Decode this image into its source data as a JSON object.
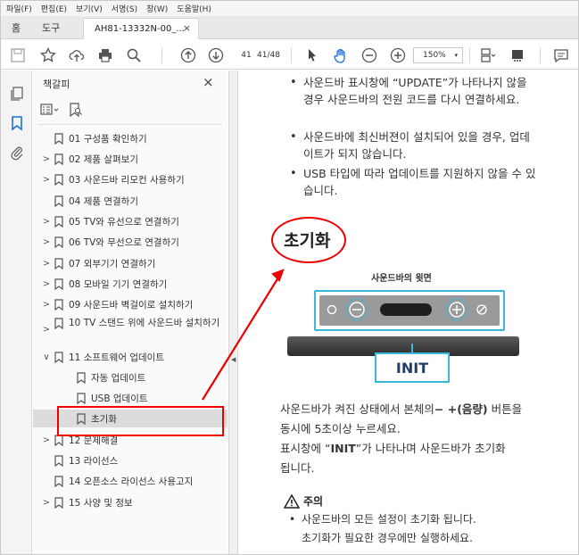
{
  "menu": [
    "파일(F)",
    "편집(E)",
    "보기(V)",
    "서명(S)",
    "창(W)",
    "도움말(H)"
  ],
  "tabs": {
    "home": "홈",
    "tools": "도구",
    "doc": "AH81-13332N-00_...",
    "close": "×"
  },
  "toolbar": {
    "page_current": "41",
    "page_total": "41/48",
    "zoom": "150%",
    "zoom_caret": "▾"
  },
  "panel": {
    "title": "책갈피",
    "close": "×",
    "items": [
      {
        "label": "01 구성품 확인하기",
        "expandable": false,
        "level": 0
      },
      {
        "label": "02 제품 살펴보기",
        "expandable": true,
        "level": 0
      },
      {
        "label": "03 사운드바 리모컨 사용하기",
        "expandable": true,
        "level": 0
      },
      {
        "label": "04 제품 연결하기",
        "expandable": false,
        "level": 0
      },
      {
        "label": "05 TV와 유선으로 연결하기",
        "expandable": true,
        "level": 0
      },
      {
        "label": "06 TV와 무선으로 연결하기",
        "expandable": true,
        "level": 0
      },
      {
        "label": "07 외부기기 연결하기",
        "expandable": true,
        "level": 0
      },
      {
        "label": "08 모바일 기기 연결하기",
        "expandable": true,
        "level": 0
      },
      {
        "label": "09 사운드바 벽걸이로 설치하기",
        "expandable": true,
        "level": 0
      },
      {
        "label": "10 TV 스탠드 위에 사운드바 설치하기",
        "expandable": true,
        "level": 0
      },
      {
        "label": "11 소프트웨어 업데이트",
        "expandable": true,
        "expanded": true,
        "level": 0
      },
      {
        "label": "자동 업데이트",
        "expandable": false,
        "level": 1
      },
      {
        "label": "USB 업데이트",
        "expandable": false,
        "level": 1
      },
      {
        "label": "초기화",
        "expandable": false,
        "level": 1,
        "selected": true
      },
      {
        "label": "12 문제해결",
        "expandable": true,
        "level": 0
      },
      {
        "label": "13 라이선스",
        "expandable": false,
        "level": 0
      },
      {
        "label": "14 오픈소스 라이선스 사용고지",
        "expandable": false,
        "level": 0
      },
      {
        "label": "15 사양 및 정보",
        "expandable": true,
        "level": 0
      }
    ]
  },
  "document": {
    "bullets": [
      "사운드바 표시창에 “UPDATE”가 나타나지 않을 경우 사운드바의 전원 코드를 다시 연결하세요.",
      "사운드바에 최신버젼이 설치되어 있을 경우, 업데이트가 되지 않습니다.",
      "USB 타입에 따라 업데이트를 지원하지 않을 수 있습니다."
    ],
    "heading": "초기화",
    "figure_title": "사운드바의 윗면",
    "init_label": "INIT",
    "para_line1_a": "사운드바가 켜진 상태에서 본체의",
    "para_line1_b": "− +(음량)",
    "para_line1_c": " 버튼을",
    "para_line2": "동시에 5초이상 누르세요.",
    "para_line3_a": "표시창에 “",
    "para_line3_b": "INIT",
    "para_line3_c": "”가 나타나며 사운드바가 초기화",
    "para_line4": "됩니다.",
    "caution_title": "주의",
    "caution_line1": "사운드바의 모든 설정이 초기화 됩니다.",
    "caution_line2": "초기화가 필요한 경우에만 실행하세요."
  },
  "colors": {
    "annotation": "#e00000",
    "figure_outline": "#3ab8d8"
  }
}
